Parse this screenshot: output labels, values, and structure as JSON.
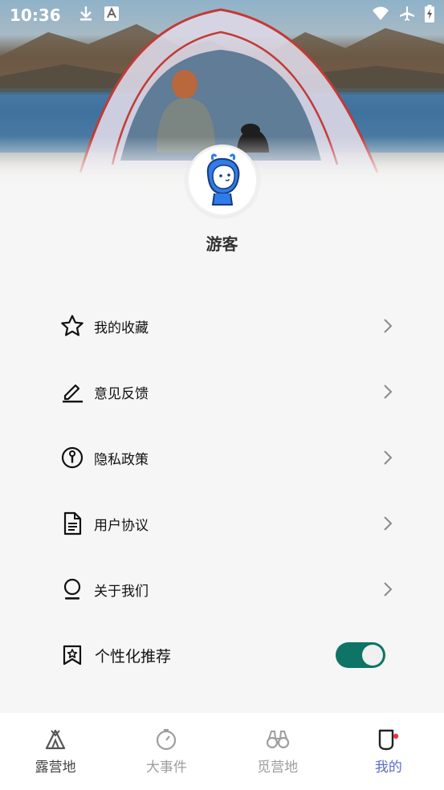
{
  "status_bar": {
    "time": "10:36"
  },
  "profile": {
    "username": "游客"
  },
  "menu": {
    "items": [
      {
        "label": "我的收藏",
        "icon": "star-icon"
      },
      {
        "label": "意见反馈",
        "icon": "pen-icon"
      },
      {
        "label": "隐私政策",
        "icon": "privacy-icon"
      },
      {
        "label": "用户协议",
        "icon": "document-icon"
      },
      {
        "label": "关于我们",
        "icon": "about-icon"
      }
    ],
    "toggle": {
      "label": "个性化推荐",
      "icon": "recommend-icon",
      "enabled": true
    }
  },
  "bottom_nav": {
    "items": [
      {
        "label": "露营地",
        "icon": "tent-icon"
      },
      {
        "label": "大事件",
        "icon": "stopwatch-icon"
      },
      {
        "label": "觅营地",
        "icon": "binoculars-icon"
      },
      {
        "label": "我的",
        "icon": "cup-icon"
      }
    ],
    "active_index": 3
  },
  "colors": {
    "toggle_on": "#0e7466",
    "nav_active": "#5a6bd1",
    "nav_inactive": "#9e9e9e",
    "avatar_blue": "#2f7be8"
  }
}
